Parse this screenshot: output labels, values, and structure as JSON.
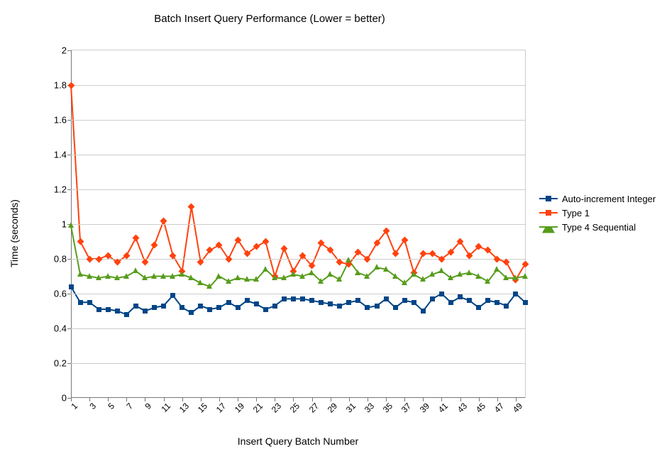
{
  "chart_data": {
    "type": "line",
    "title": "Batch Insert Query Performance (Lower = better)",
    "xlabel": "Insert Query Batch Number",
    "ylabel": "Time (seconds)",
    "xlim": [
      1,
      50
    ],
    "ylim": [
      0,
      2
    ],
    "yticks": [
      0,
      0.2,
      0.4,
      0.6,
      0.8,
      1,
      1.2,
      1.4,
      1.6,
      1.8,
      2
    ],
    "xtick_labels": [
      1,
      3,
      5,
      7,
      9,
      11,
      13,
      15,
      17,
      19,
      21,
      23,
      25,
      27,
      29,
      31,
      33,
      35,
      37,
      39,
      41,
      43,
      45,
      47,
      49
    ],
    "x": [
      1,
      2,
      3,
      4,
      5,
      6,
      7,
      8,
      9,
      10,
      11,
      12,
      13,
      14,
      15,
      16,
      17,
      18,
      19,
      20,
      21,
      22,
      23,
      24,
      25,
      26,
      27,
      28,
      29,
      30,
      31,
      32,
      33,
      34,
      35,
      36,
      37,
      38,
      39,
      40,
      41,
      42,
      43,
      44,
      45,
      46,
      47,
      48,
      49,
      50
    ],
    "series": [
      {
        "name": "Auto-increment Integer",
        "color": "#004586",
        "marker": "square",
        "values": [
          0.64,
          0.55,
          0.55,
          0.51,
          0.51,
          0.5,
          0.48,
          0.53,
          0.5,
          0.52,
          0.53,
          0.59,
          0.52,
          0.49,
          0.53,
          0.51,
          0.52,
          0.55,
          0.52,
          0.56,
          0.54,
          0.51,
          0.53,
          0.57,
          0.57,
          0.57,
          0.56,
          0.55,
          0.54,
          0.53,
          0.55,
          0.56,
          0.52,
          0.53,
          0.57,
          0.52,
          0.56,
          0.55,
          0.5,
          0.57,
          0.6,
          0.55,
          0.58,
          0.56,
          0.52,
          0.56,
          0.55,
          0.53,
          0.6,
          0.55
        ]
      },
      {
        "name": "Type 1",
        "color": "#ff420e",
        "marker": "diamond",
        "values": [
          1.8,
          0.9,
          0.8,
          0.8,
          0.82,
          0.78,
          0.82,
          0.92,
          0.78,
          0.88,
          1.02,
          0.82,
          0.73,
          1.1,
          0.78,
          0.85,
          0.88,
          0.8,
          0.91,
          0.83,
          0.87,
          0.9,
          0.7,
          0.86,
          0.73,
          0.82,
          0.76,
          0.89,
          0.85,
          0.78,
          0.77,
          0.84,
          0.8,
          0.89,
          0.96,
          0.83,
          0.91,
          0.72,
          0.83,
          0.83,
          0.8,
          0.84,
          0.9,
          0.82,
          0.87,
          0.85,
          0.8,
          0.78,
          0.68,
          0.77
        ]
      },
      {
        "name": "Type 4 Sequential",
        "color": "#579d1c",
        "marker": "triangle",
        "values": [
          0.99,
          0.71,
          0.7,
          0.69,
          0.7,
          0.69,
          0.7,
          0.73,
          0.69,
          0.7,
          0.7,
          0.7,
          0.71,
          0.69,
          0.66,
          0.64,
          0.7,
          0.67,
          0.69,
          0.68,
          0.68,
          0.74,
          0.69,
          0.69,
          0.71,
          0.7,
          0.72,
          0.67,
          0.71,
          0.68,
          0.79,
          0.72,
          0.7,
          0.75,
          0.74,
          0.7,
          0.66,
          0.71,
          0.68,
          0.71,
          0.73,
          0.69,
          0.71,
          0.72,
          0.7,
          0.67,
          0.74,
          0.69,
          0.69,
          0.7
        ]
      }
    ],
    "legend_position": "right"
  }
}
